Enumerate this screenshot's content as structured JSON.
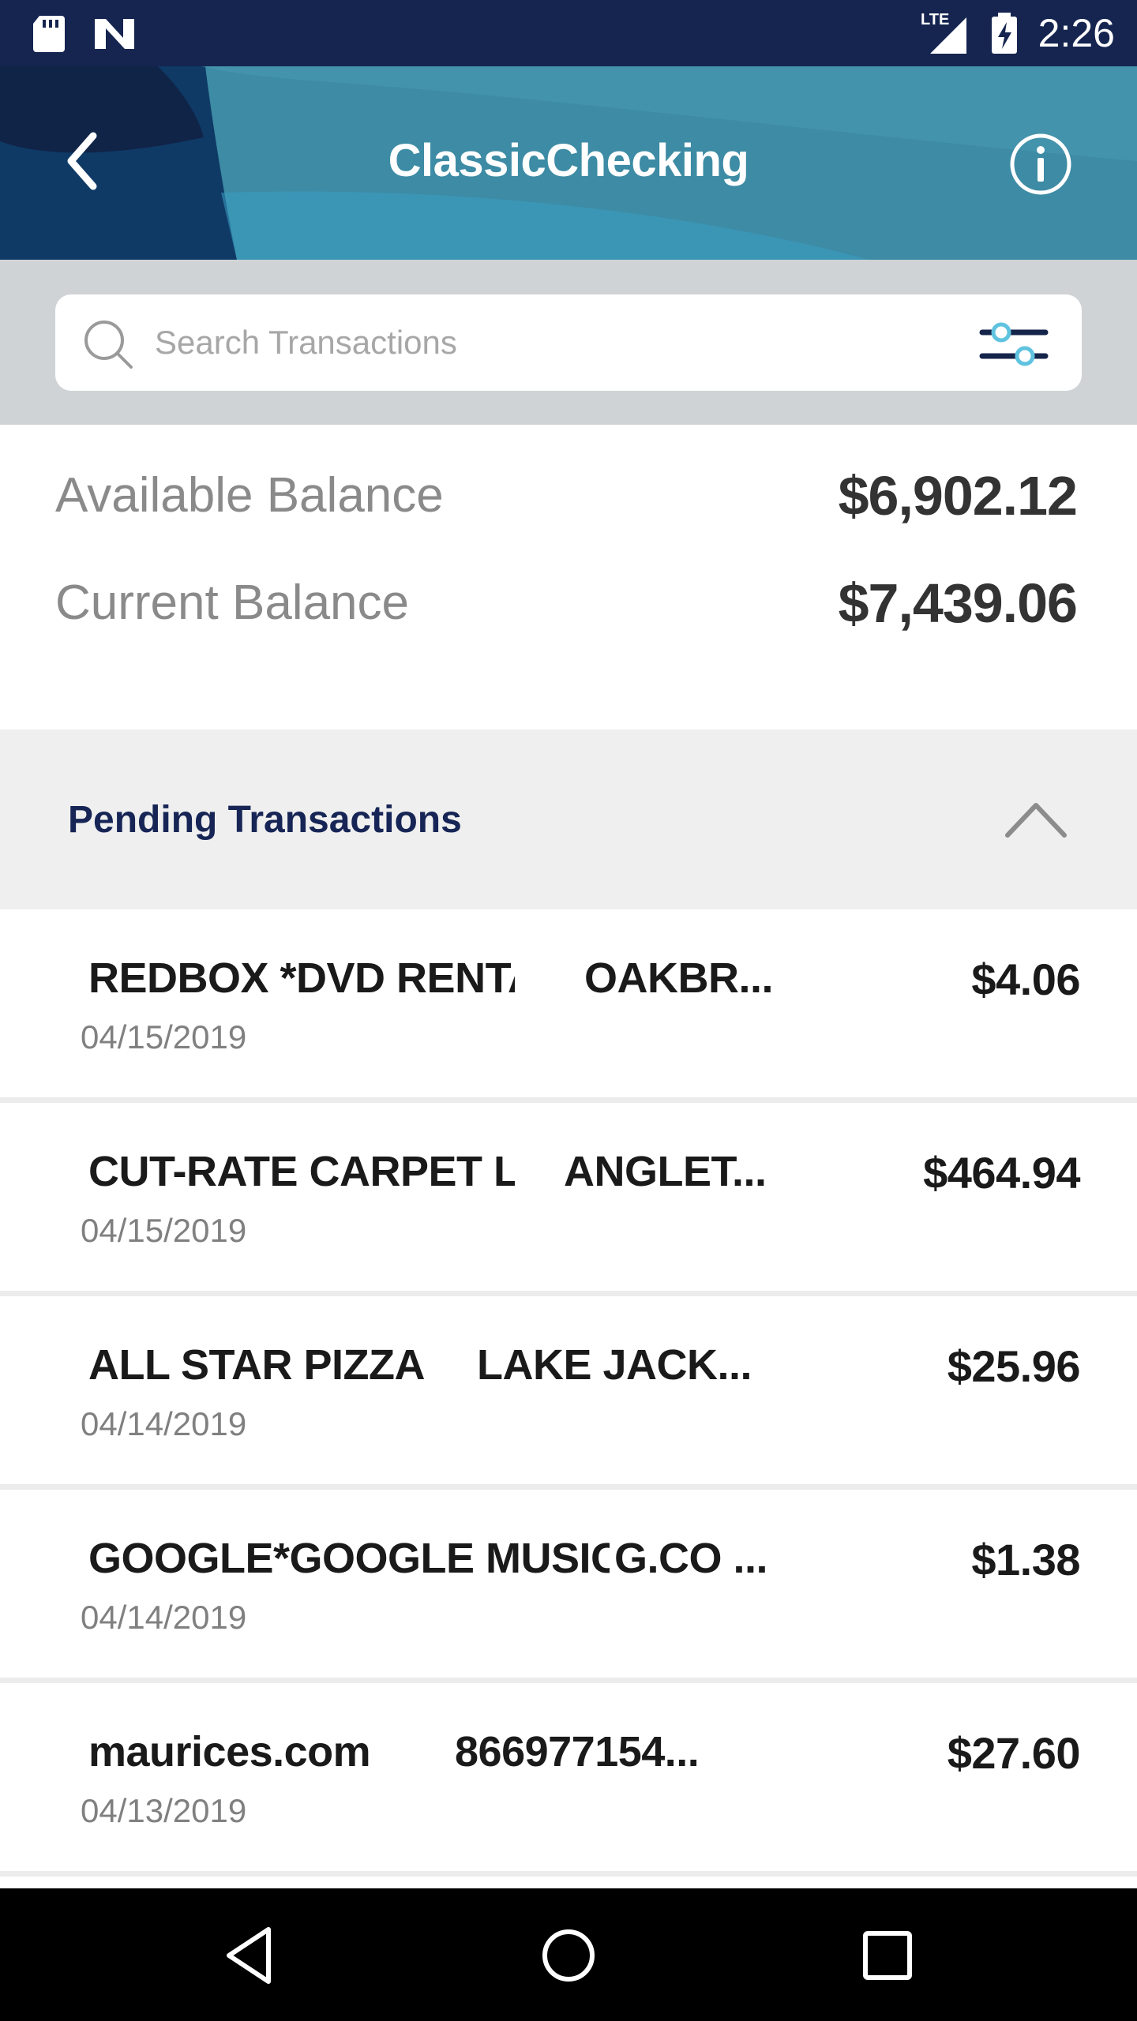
{
  "status_bar": {
    "time": "2:26",
    "network": "LTE",
    "icons": [
      "sd-card-icon",
      "n-notification-icon",
      "signal-icon",
      "battery-charging-icon"
    ]
  },
  "header": {
    "title": "ClassicChecking",
    "back_icon": "chevron-left-icon",
    "info_icon": "info-icon"
  },
  "search": {
    "placeholder": "Search Transactions",
    "value": "",
    "filter_icon": "filter-sliders-icon"
  },
  "balances": {
    "available_label": "Available Balance",
    "available_value": "$6,902.12",
    "current_label": "Current Balance",
    "current_value": "$7,439.06"
  },
  "pending": {
    "label": "Pending Transactions",
    "toggle_icon": "chevron-up-icon",
    "transactions": [
      {
        "name": "REDBOX *DVD RENTAL",
        "location": "OAKBR...",
        "amount": "$4.06",
        "date": "04/15/2019"
      },
      {
        "name": "CUT-RATE CARPET LLC",
        "location": "ANGLET...",
        "amount": "$464.94",
        "date": "04/15/2019"
      },
      {
        "name": "ALL STAR PIZZA",
        "location": "LAKE JACK...",
        "amount": "$25.96",
        "date": "04/14/2019"
      },
      {
        "name": "GOOGLE*GOOGLE MUSIC",
        "location": "G.CO ...",
        "amount": "$1.38",
        "date": "04/14/2019"
      },
      {
        "name": "maurices.com",
        "location": "866977154...",
        "amount": "$27.60",
        "date": "04/13/2019"
      }
    ]
  },
  "colors": {
    "status_bar": "#152550",
    "header_accent": "#3d8ba4",
    "pending_title": "#162555",
    "search_band": "#cfd3d6"
  }
}
